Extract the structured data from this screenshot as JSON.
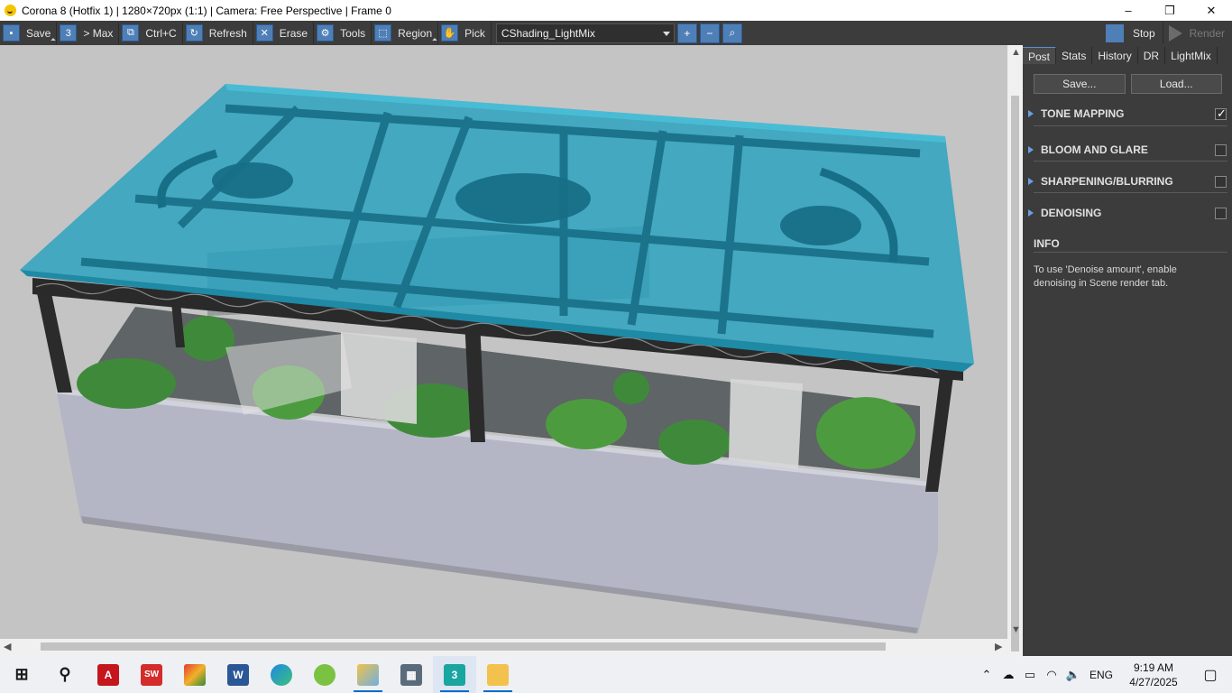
{
  "window": {
    "title": "Corona 8 (Hotfix 1) | 1280×720px (1:1) | Camera: Free Perspective | Frame 0",
    "controls": [
      "–",
      "❐",
      "✕"
    ]
  },
  "toolbar": {
    "save": "Save",
    "max": "> Max",
    "ctrlc": "Ctrl+C",
    "refresh": "Refresh",
    "erase": "Erase",
    "tools": "Tools",
    "region": "Region",
    "pick": "Pick",
    "render_element": "CShading_LightMix",
    "stop": "Stop",
    "render": "Render"
  },
  "panel": {
    "tabs": [
      "Post",
      "Stats",
      "History",
      "DR",
      "LightMix"
    ],
    "active_tab": "Post",
    "save_button": "Save...",
    "load_button": "Load...",
    "sections": [
      {
        "label": "TONE MAPPING",
        "checked": true
      },
      {
        "label": "BLOOM AND GLARE",
        "checked": false
      },
      {
        "label": "SHARPENING/BLURRING",
        "checked": false
      },
      {
        "label": "DENOISING",
        "checked": false
      }
    ],
    "info_title": "INFO",
    "info_text": "To use 'Denoise amount', enable denoising in Scene render tab."
  },
  "taskbar": {
    "language": "ENG",
    "time": "9:19 AM",
    "date": "4/27/2025"
  },
  "colors": {
    "accent": "#4f7fb7",
    "glass": "#2aa6c4",
    "panel_bg": "#3c3c3c"
  }
}
